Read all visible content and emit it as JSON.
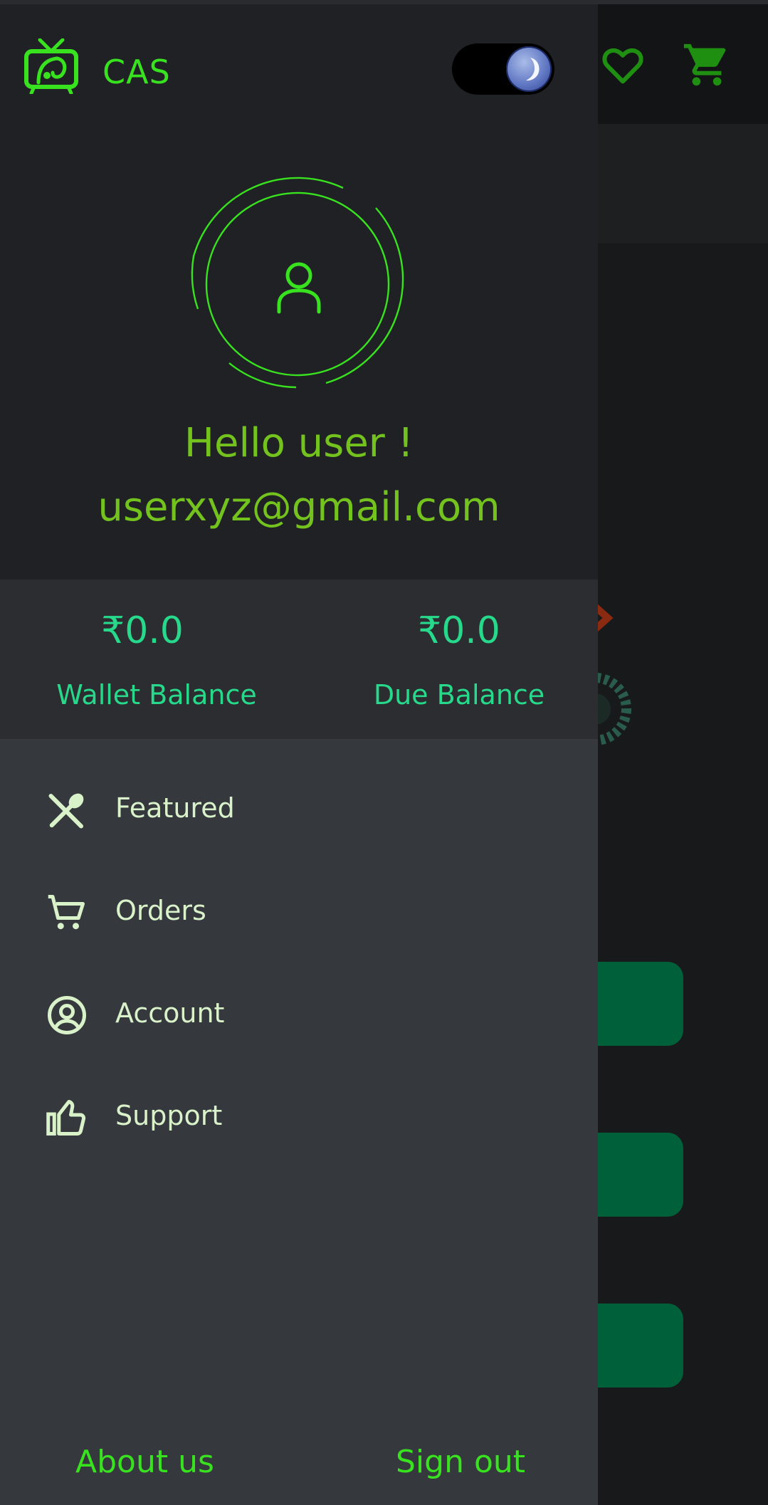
{
  "app": {
    "brand": "CAS",
    "brand_color": "#39e21f"
  },
  "theme_toggle": {
    "state": "dark",
    "icon": "moon-icon"
  },
  "profile": {
    "avatar_icon": "user-icon",
    "greeting": "Hello user !",
    "email": "userxyz@gmail.com"
  },
  "balances": {
    "wallet": {
      "amount": "₹0.0",
      "label": "Wallet Balance"
    },
    "due": {
      "amount": "₹0.0",
      "label": "Due Balance"
    }
  },
  "menu": {
    "items": [
      {
        "label": "Featured",
        "icon": "fork-spoon-icon"
      },
      {
        "label": "Orders",
        "icon": "cart-icon"
      },
      {
        "label": "Account",
        "icon": "account-circle-icon"
      },
      {
        "label": "Support",
        "icon": "thumbs-up-icon"
      }
    ]
  },
  "footer": {
    "about_label": "About us",
    "signout_label": "Sign out"
  },
  "background_header": {
    "icons": [
      "heart-icon",
      "cart-icon"
    ]
  },
  "colors": {
    "drawer_bg": "#35383d",
    "header_bg": "#1f2124",
    "balance_bg": "#2b2d31",
    "accent_green": "#39e21f",
    "greeting_green": "#73c21d",
    "balance_teal": "#27d98b",
    "menu_text": "#d9f2c9",
    "bg_button": "#006039"
  }
}
